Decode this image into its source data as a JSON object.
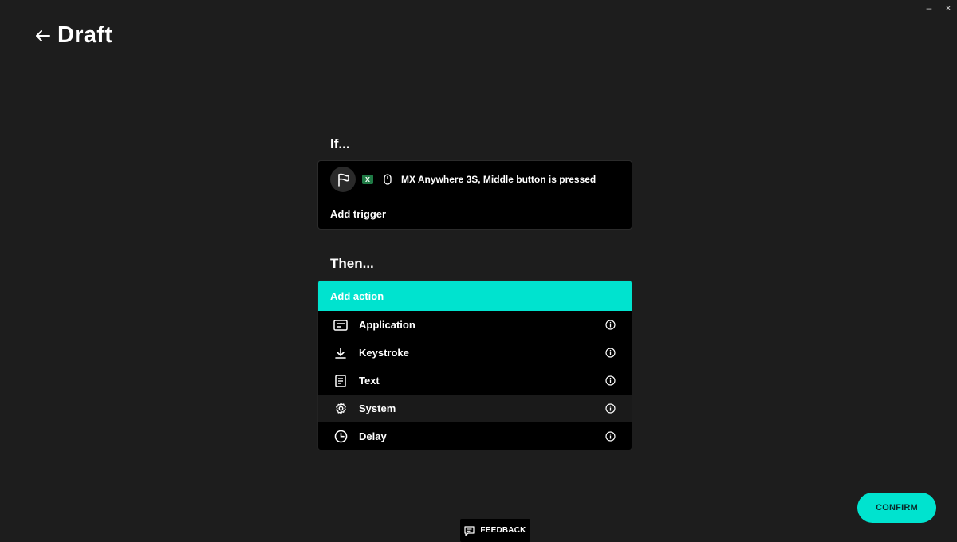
{
  "window_controls": {
    "minimize": "–",
    "close": "×"
  },
  "header": {
    "title": "Draft"
  },
  "if_section": {
    "label": "If...",
    "trigger": {
      "excel_glyph": "X",
      "text": "MX Anywhere 3S, Middle button is pressed"
    },
    "add_trigger_label": "Add trigger"
  },
  "then_section": {
    "label": "Then...",
    "add_action_label": "Add action",
    "actions": [
      {
        "label": "Application",
        "icon": "application-window-icon"
      },
      {
        "label": "Keystroke",
        "icon": "download-arrow-icon"
      },
      {
        "label": "Text",
        "icon": "document-text-icon"
      },
      {
        "label": "System",
        "icon": "gear-icon"
      },
      {
        "label": "Delay",
        "icon": "clock-icon"
      }
    ]
  },
  "confirm_label": "CONFIRM",
  "feedback_label": "FEEDBACK",
  "colors": {
    "background": "#1d1d1d",
    "card": "#000000",
    "accent": "#00e3cf",
    "text": "#ffffff"
  }
}
